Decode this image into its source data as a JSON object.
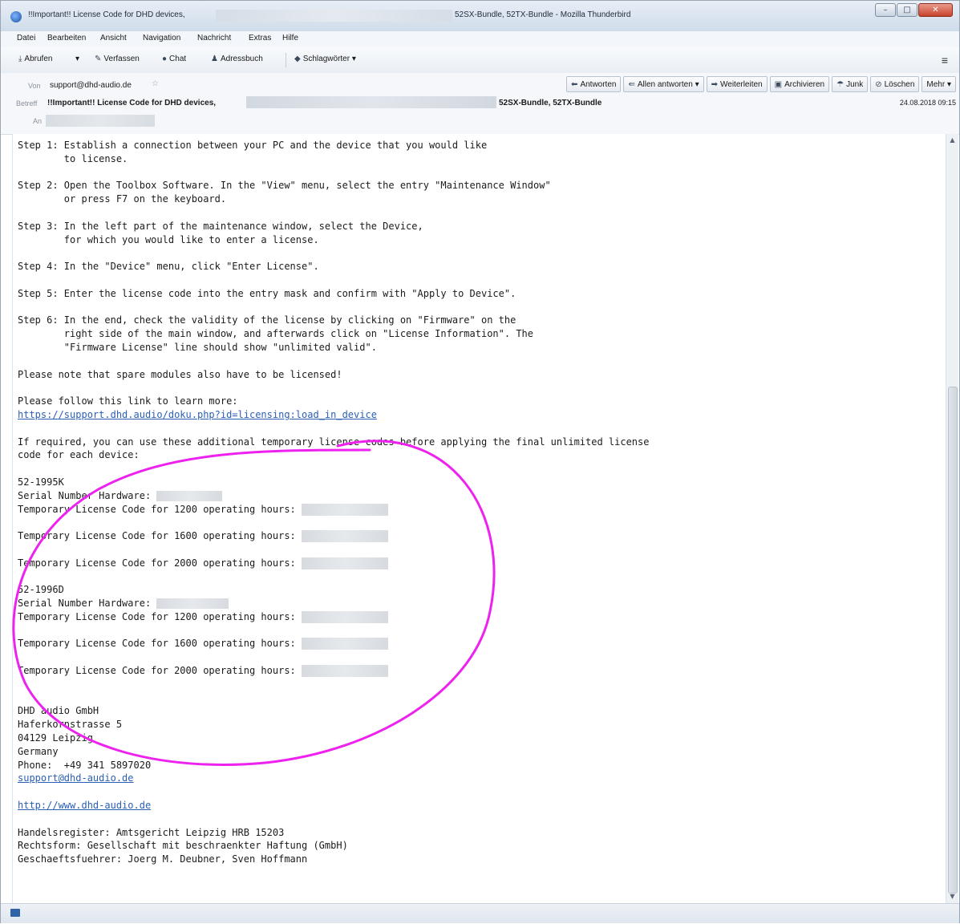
{
  "window": {
    "title_left": "!!Important!! License Code for DHD devices,",
    "title_right": "52SX-Bundle, 52TX-Bundle - Mozilla Thunderbird",
    "minimize": "–",
    "maximize": "□",
    "close": "✕"
  },
  "menubar": [
    "Datei",
    "Bearbeiten",
    "Ansicht",
    "Navigation",
    "Nachricht",
    "Extras",
    "Hilfe"
  ],
  "toolbar": {
    "get_mail": "Abrufen",
    "dropdown": "▾",
    "compose": "Verfassen",
    "chat": "Chat",
    "address_book": "Adressbuch",
    "tags": "Schlagwörter ▾",
    "menu": "≡"
  },
  "header": {
    "from_label": "Von",
    "from_value": "support@dhd-audio.de",
    "subject_label": "Betreff",
    "subject_left": "!!Important!! License Code for DHD devices,",
    "subject_right": "52SX-Bundle, 52TX-Bundle",
    "date": "24.08.2018 09:15",
    "to_label": "An",
    "actions": {
      "reply": "Antworten",
      "reply_all": "Allen antworten",
      "forward": "Weiterleiten",
      "archive": "Archivieren",
      "junk": "Junk",
      "delete": "Löschen",
      "more": "Mehr ▾"
    }
  },
  "body": {
    "step1": "Step 1: Establish a connection between your PC and the device that you would like\n        to license.",
    "step2": "Step 2: Open the Toolbox Software. In the \"View\" menu, select the entry \"Maintenance Window\"\n        or press F7 on the keyboard.",
    "step3": "Step 3: In the left part of the maintenance window, select the Device,\n        for which you would like to enter a license.",
    "step4": "Step 4: In the \"Device\" menu, click \"Enter License\".",
    "step5": "Step 5: Enter the license code into the entry mask and confirm with \"Apply to Device\".",
    "step6": "Step 6: In the end, check the validity of the license by clicking on \"Firmware\" on the\n        right side of the main window, and afterwards click on \"License Information\". The\n        \"Firmware License\" line should show \"unlimited valid\".",
    "note": "Please note that spare modules also have to be licensed!",
    "follow": "Please follow this link to learn more:",
    "link": "https://support.dhd.audio/doku.php?id=licensing:load_in_device",
    "required": "If required, you can use these additional temporary license codes before applying the final unlimited license\ncode for each device:",
    "device1": "52-1995K",
    "device2": "52-1996D",
    "serial": "Serial Number Hardware: ",
    "temp1200": "Temporary License Code for 1200 operating hours: ",
    "temp1600": "Temporary License Code for 1600 operating hours: ",
    "temp2000": "Temporary License Code for 2000 operating hours: ",
    "company": "DHD audio GmbH",
    "street": "Haferkornstrasse 5",
    "city": "04129 Leipzig",
    "country": "Germany",
    "phone": "Phone:  +49 341 5897020",
    "email": "support@dhd-audio.de",
    "website": "http://www.dhd-audio.de",
    "register": "Handelsregister: Amtsgericht Leipzig HRB 15203",
    "legal": "Rechtsform: Gesellschaft mit beschraenkter Haftung (GmbH)",
    "managers": "Geschaeftsfuehrer: Joerg M. Deubner, Sven Hoffmann"
  },
  "scrollbar": {
    "up": "▲",
    "down": "▼"
  },
  "colors": {
    "annotation": "#ee22ee",
    "link": "#2b5fb4"
  }
}
